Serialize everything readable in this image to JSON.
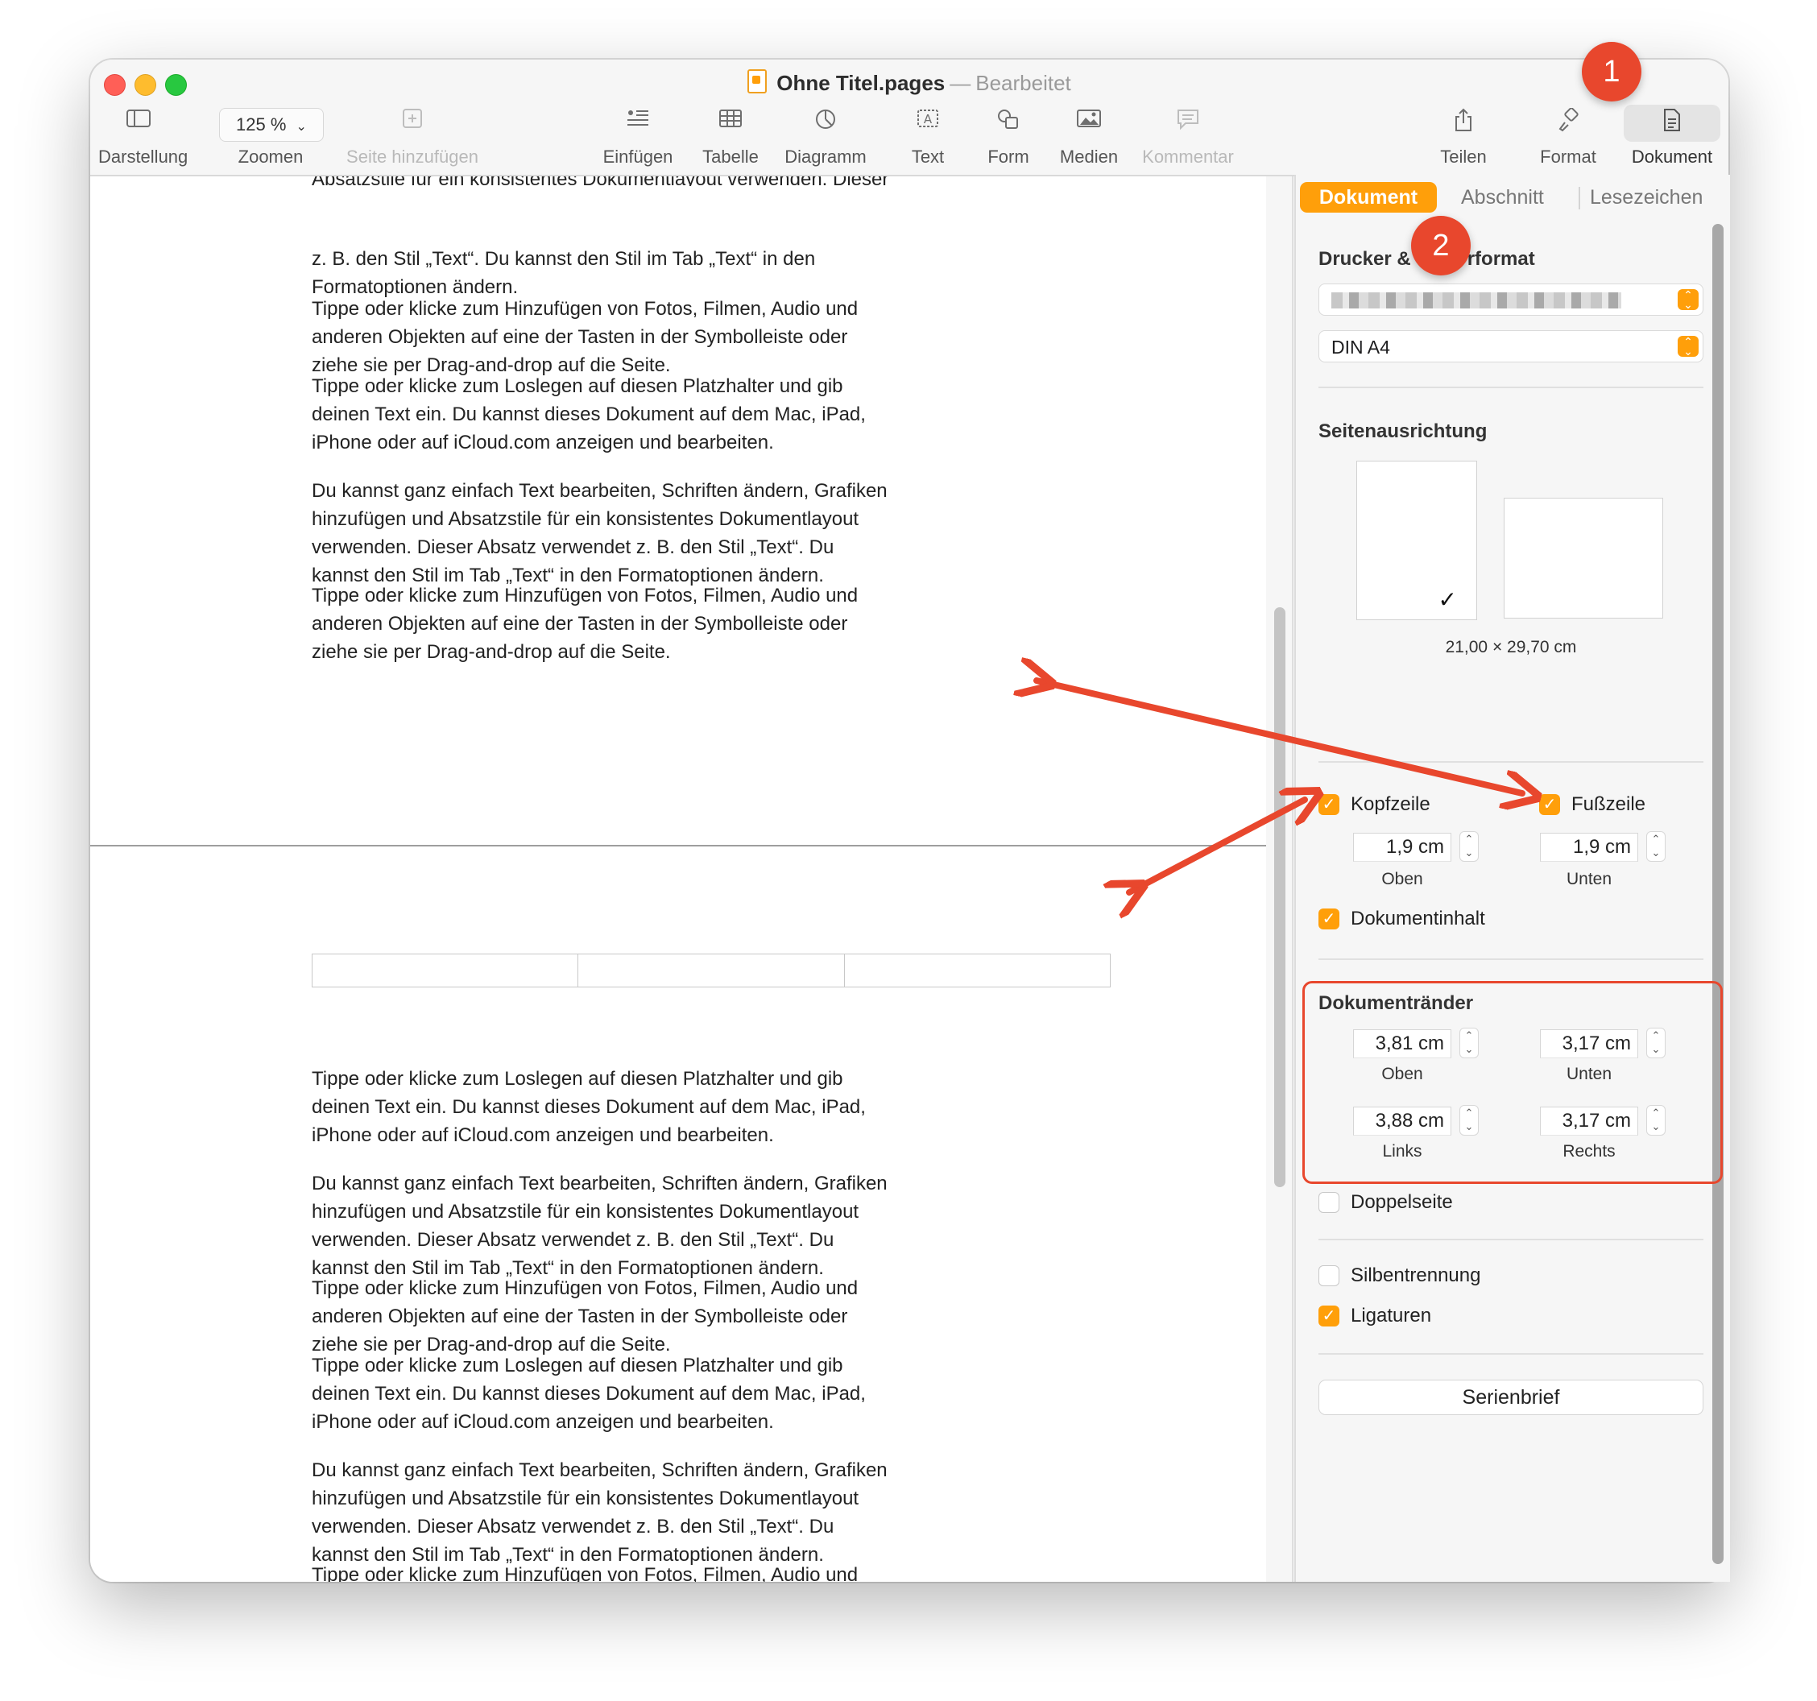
{
  "window": {
    "title": "Ohne Titel.pages",
    "title_separator": "—",
    "status": "Bearbeitet"
  },
  "toolbar": {
    "darstellung": "Darstellung",
    "zoom_value": "125 %",
    "zoomen": "Zoomen",
    "seite_hinzufuegen": "Seite hinzufügen",
    "einfuegen": "Einfügen",
    "tabelle": "Tabelle",
    "diagramm": "Diagramm",
    "text": "Text",
    "form": "Form",
    "medien": "Medien",
    "kommentar": "Kommentar",
    "teilen": "Teilen",
    "format": "Format",
    "dokument": "Dokument"
  },
  "document": {
    "cut_line_1": "Absatzstile für ein konsistentes Dokumentlayout verwenden. Dieser Absatz verwendet",
    "cut_line_2": "z. B. den Stil „Text“. Du kannst den Stil im Tab „Text“ in den Formatoptionen ändern.",
    "page1_paragraphs": [
      "Tippe oder klicke zum Hinzufügen von Fotos, Filmen, Audio und anderen Objekten auf eine der Tasten in der Symbolleiste oder ziehe sie per Drag-and-drop auf die Seite.",
      "Tippe oder klicke zum Loslegen auf diesen Platzhalter und gib deinen Text ein. Du kannst dieses Dokument auf dem Mac, iPad, iPhone oder auf iCloud.com anzeigen und bearbeiten.",
      "Du kannst ganz einfach Text bearbeiten, Schriften ändern, Grafiken hinzufügen und Absatzstile für ein konsistentes Dokumentlayout verwenden. Dieser Absatz verwendet z. B. den Stil „Text“. Du kannst den Stil im Tab „Text“ in den Formatoptionen ändern.",
      "Tippe oder klicke zum Hinzufügen von Fotos, Filmen, Audio und anderen Objekten auf eine der Tasten in der Symbolleiste oder ziehe sie per Drag-and-drop auf die Seite."
    ],
    "page2_paragraphs": [
      "Tippe oder klicke zum Loslegen auf diesen Platzhalter und gib deinen Text ein. Du kannst dieses Dokument auf dem Mac, iPad, iPhone oder auf iCloud.com anzeigen und bearbeiten.",
      "Du kannst ganz einfach Text bearbeiten, Schriften ändern, Grafiken hinzufügen und Absatzstile für ein konsistentes Dokumentlayout verwenden. Dieser Absatz verwendet z. B. den Stil „Text“. Du kannst den Stil im Tab „Text“ in den Formatoptionen ändern.",
      "Tippe oder klicke zum Hinzufügen von Fotos, Filmen, Audio und anderen Objekten auf eine der Tasten in der Symbolleiste oder ziehe sie per Drag-and-drop auf die Seite.",
      "Tippe oder klicke zum Loslegen auf diesen Platzhalter und gib deinen Text ein. Du kannst dieses Dokument auf dem Mac, iPad, iPhone oder auf iCloud.com anzeigen und bearbeiten.",
      "Du kannst ganz einfach Text bearbeiten, Schriften ändern, Grafiken hinzufügen und Absatzstile für ein konsistentes Dokumentlayout verwenden. Dieser Absatz verwendet z. B. den Stil „Text“. Du kannst den Stil im Tab „Text“ in den Formatoptionen ändern.",
      "Tippe oder klicke zum Hinzufügen von Fotos, Filmen, Audio und anderen Objekten auf eine der Tasten in der Symbolleiste oder ziehe sie per Drag-and-drop auf die Seite."
    ]
  },
  "inspector": {
    "tabs": [
      "Dokument",
      "Abschnitt",
      "Lesezeichen"
    ],
    "printer_section_prefix": "Drucker &",
    "printer_section_suffix": "rformat",
    "paper_size": "DIN A4",
    "orientation_title": "Seitenausrichtung",
    "page_size": "21,00 × 29,70 cm",
    "kopfzeile": "Kopfzeile",
    "fusszeile": "Fußzeile",
    "header_value": "1,9 cm",
    "header_label": "Oben",
    "footer_value": "1,9 cm",
    "footer_label": "Unten",
    "dokumentinhalt": "Dokumentinhalt",
    "margins_title": "Dokumentränder",
    "margin_top": "3,81 cm",
    "margin_top_label": "Oben",
    "margin_bottom": "3,17 cm",
    "margin_bottom_label": "Unten",
    "margin_left": "3,88 cm",
    "margin_left_label": "Links",
    "margin_right": "3,17 cm",
    "margin_right_label": "Rechts",
    "doppelseite": "Doppelseite",
    "silbentrennung": "Silbentrennung",
    "ligaturen": "Ligaturen",
    "serienbrief": "Serienbrief"
  },
  "annotations": {
    "badge_1": "1",
    "badge_2": "2",
    "arrow_color": "#e8472d"
  },
  "colors": {
    "accent": "#ff9f0a",
    "annotation": "#e8472d"
  }
}
